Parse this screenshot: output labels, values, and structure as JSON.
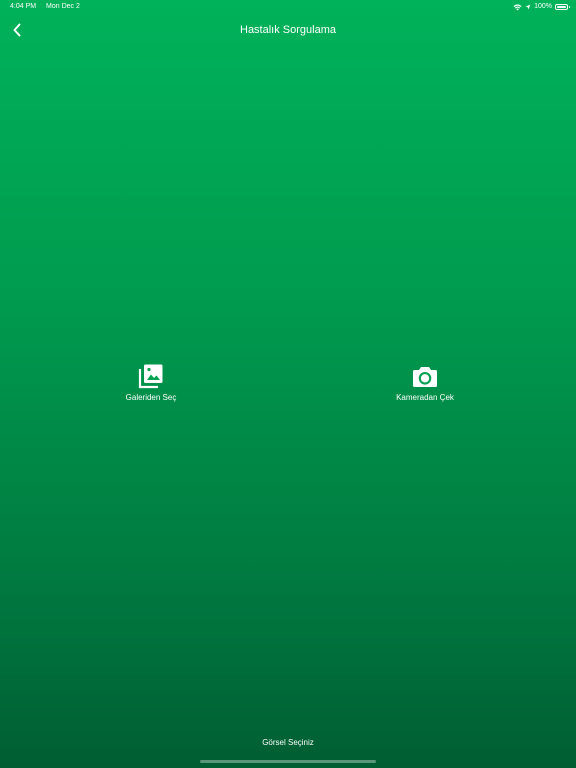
{
  "status_bar": {
    "time": "4:04 PM",
    "date": "Mon Dec 2",
    "battery": "100%",
    "icons": [
      "wifi-icon",
      "location-arrow-icon",
      "battery-icon"
    ]
  },
  "nav": {
    "title": "Hastalık Sorgulama",
    "back_icon": "chevron-left-icon"
  },
  "actions": {
    "gallery": {
      "label": "Galeriden Seç",
      "icon": "photo-library-icon"
    },
    "camera": {
      "label": "Kameradan Çek",
      "icon": "camera-icon"
    }
  },
  "footer": {
    "prompt": "Görsel Seçiniz"
  },
  "colors": {
    "gradient_top": "#00b25a",
    "gradient_bottom": "#005e33",
    "foreground": "#ffffff"
  }
}
